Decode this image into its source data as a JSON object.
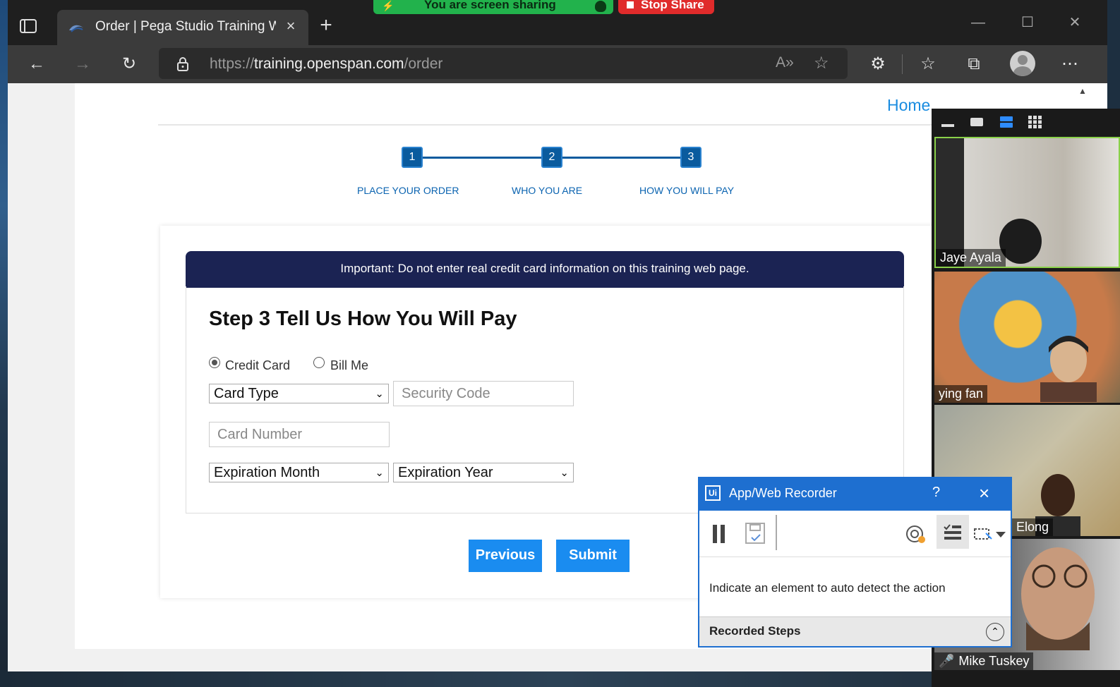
{
  "browser": {
    "tab_title": "Order | Pega Studio Training Web",
    "tab_close": "×",
    "new_tab": "+",
    "url_prefix": "https://",
    "url_host": "training.openspan.com",
    "url_path": "/order"
  },
  "screen_share": {
    "status": "You are screen sharing",
    "stop_label": "Stop Share"
  },
  "page": {
    "home_link": "Home",
    "steps": [
      {
        "number": "1",
        "label": "PLACE YOUR ORDER"
      },
      {
        "number": "2",
        "label": "WHO YOU ARE"
      },
      {
        "number": "3",
        "label": "HOW YOU WILL PAY"
      }
    ],
    "banner": "Important: Do not enter real credit card information on this training web page.",
    "form_title": "Step 3 Tell Us How You Will Pay",
    "payment_options": {
      "credit_card": "Credit Card",
      "bill_me": "Bill Me",
      "selected": "Credit Card"
    },
    "card_type": "Card Type",
    "security_code_placeholder": "Security Code",
    "card_number_placeholder": "Card Number",
    "expiration_month": "Expiration Month",
    "expiration_year": "Expiration Year",
    "previous_label": "Previous",
    "submit_label": "Submit"
  },
  "zoom": {
    "participants": [
      "Jaye Ayala",
      "ying fan",
      "Elong",
      "Mike Tuskey"
    ]
  },
  "recorder": {
    "logo": "Ui",
    "title": "App/Web Recorder",
    "help": "?",
    "close": "×",
    "message": "Indicate an element to auto detect the action",
    "recorded_steps": "Recorded Steps"
  },
  "colors": {
    "accent": "#1a8cf0",
    "banner": "#1b2353",
    "step": "#0a5b9e",
    "recorder": "#1e6fd0",
    "share_green": "#22b24c",
    "stop_red": "#e02b2b"
  }
}
